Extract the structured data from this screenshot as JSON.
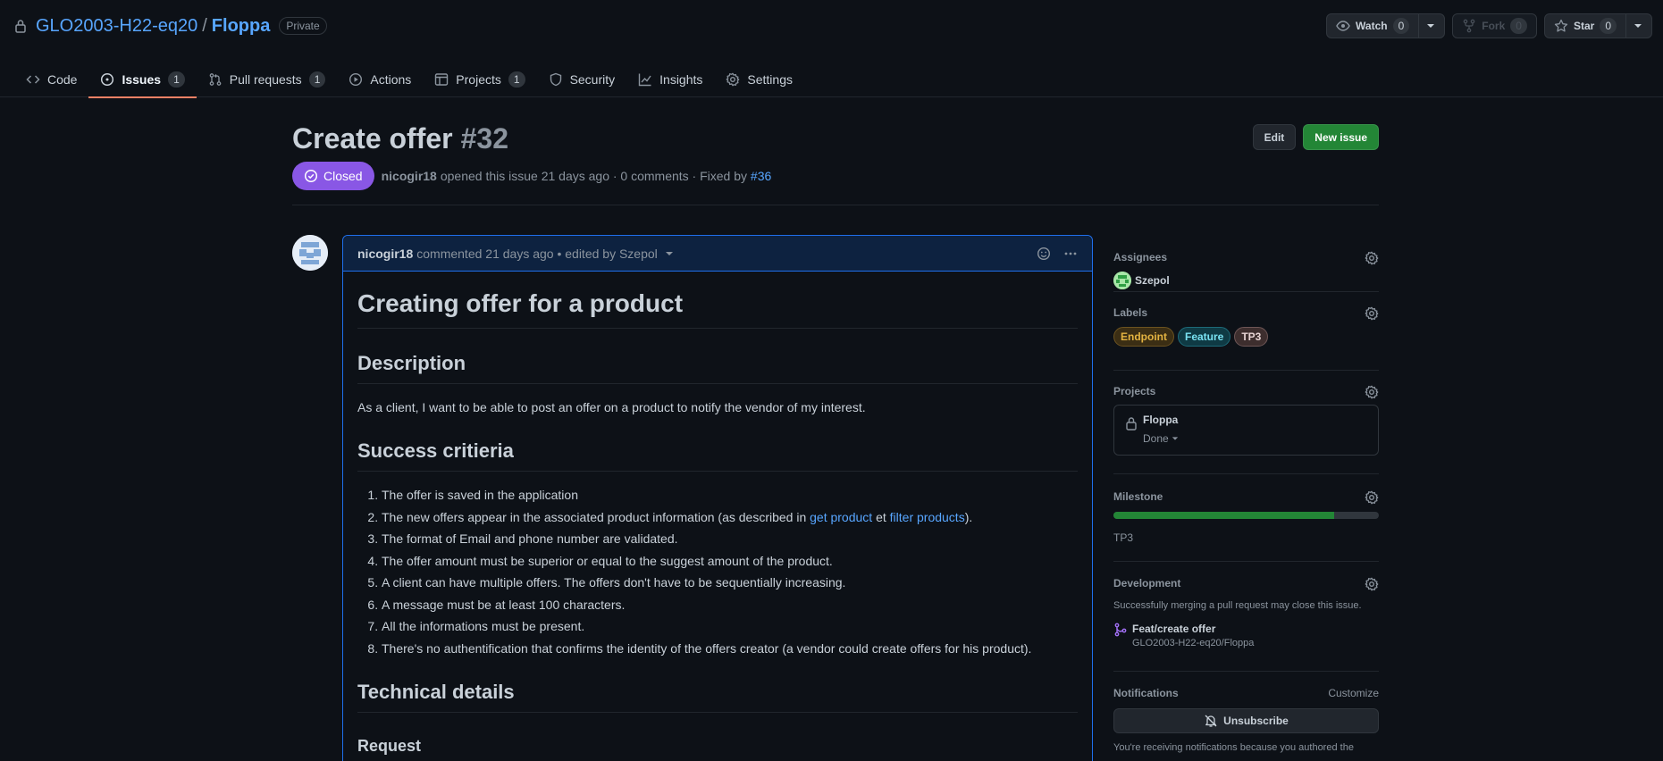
{
  "repo": {
    "owner": "GLO2003-H22-eq20",
    "separator": "/",
    "name": "Floppa",
    "visibility": "Private",
    "watch": {
      "label": "Watch",
      "count": "0"
    },
    "fork": {
      "label": "Fork",
      "count": "0"
    },
    "star": {
      "label": "Star",
      "count": "0"
    }
  },
  "nav": {
    "code": "Code",
    "issues": {
      "label": "Issues",
      "count": "1"
    },
    "pulls": {
      "label": "Pull requests",
      "count": "1"
    },
    "actions": "Actions",
    "projects": {
      "label": "Projects",
      "count": "1"
    },
    "security": "Security",
    "insights": "Insights",
    "settings": "Settings"
  },
  "issue": {
    "title": "Create offer",
    "number": "#32",
    "state": "Closed",
    "author": "nicogir18",
    "meta_text": "opened this issue 21 days ago · 0 comments · Fixed by ",
    "fixed_by": "#36",
    "edit_label": "Edit",
    "new_issue_label": "New issue"
  },
  "comment": {
    "author": "nicogir18",
    "meta": "commented 21 days ago • edited by Szepol",
    "h1": "Creating offer for a product",
    "description_heading": "Description",
    "description": "As a client, I want to be able to post an offer on a product to notify the vendor of my interest.",
    "success_heading": "Success critieria",
    "criteria": [
      "The offer is saved in the application",
      "The new offers appear in the associated product information (as described in ",
      "The format of Email and phone number are validated.",
      "The offer amount must be superior or equal to the suggest amount of the product.",
      "A client can have multiple offers. The offers don't have to be sequentially increasing.",
      "A message must be at least 100 characters.",
      "All the informations must be present.",
      "There's no authentification that confirms the identity of the offers creator (a vendor could create offers for his product)."
    ],
    "criteria_links": {
      "get_product": "get product",
      "middle": " et ",
      "filter_products": "filter products",
      "end": ")."
    },
    "technical_heading": "Technical details",
    "request_heading": "Request"
  },
  "sidebar": {
    "assignees": {
      "heading": "Assignees",
      "user": "Szepol"
    },
    "labels": {
      "heading": "Labels",
      "items": [
        {
          "name": "Endpoint",
          "color": "#e3b341",
          "bg": "#3b2e14"
        },
        {
          "name": "Feature",
          "color": "#79e2f2",
          "bg": "#0f3a44"
        },
        {
          "name": "TP3",
          "color": "#e6d3d3",
          "bg": "#3d2e2e"
        }
      ]
    },
    "projects": {
      "heading": "Projects",
      "name": "Floppa",
      "status": "Done"
    },
    "milestone": {
      "heading": "Milestone",
      "name": "TP3",
      "progress": 0.83
    },
    "development": {
      "heading": "Development",
      "note": "Successfully merging a pull request may close this issue.",
      "pr_title": "Feat/create offer",
      "pr_repo": "GLO2003-H22-eq20/Floppa"
    },
    "notifications": {
      "heading": "Notifications",
      "customize": "Customize",
      "unsubscribe": "Unsubscribe",
      "note": "You're receiving notifications because you authored the"
    }
  },
  "colors": {
    "accent": "#58a6ff",
    "closed": "#8957e5",
    "primary": "#238636",
    "tab_underline": "#f78166"
  }
}
